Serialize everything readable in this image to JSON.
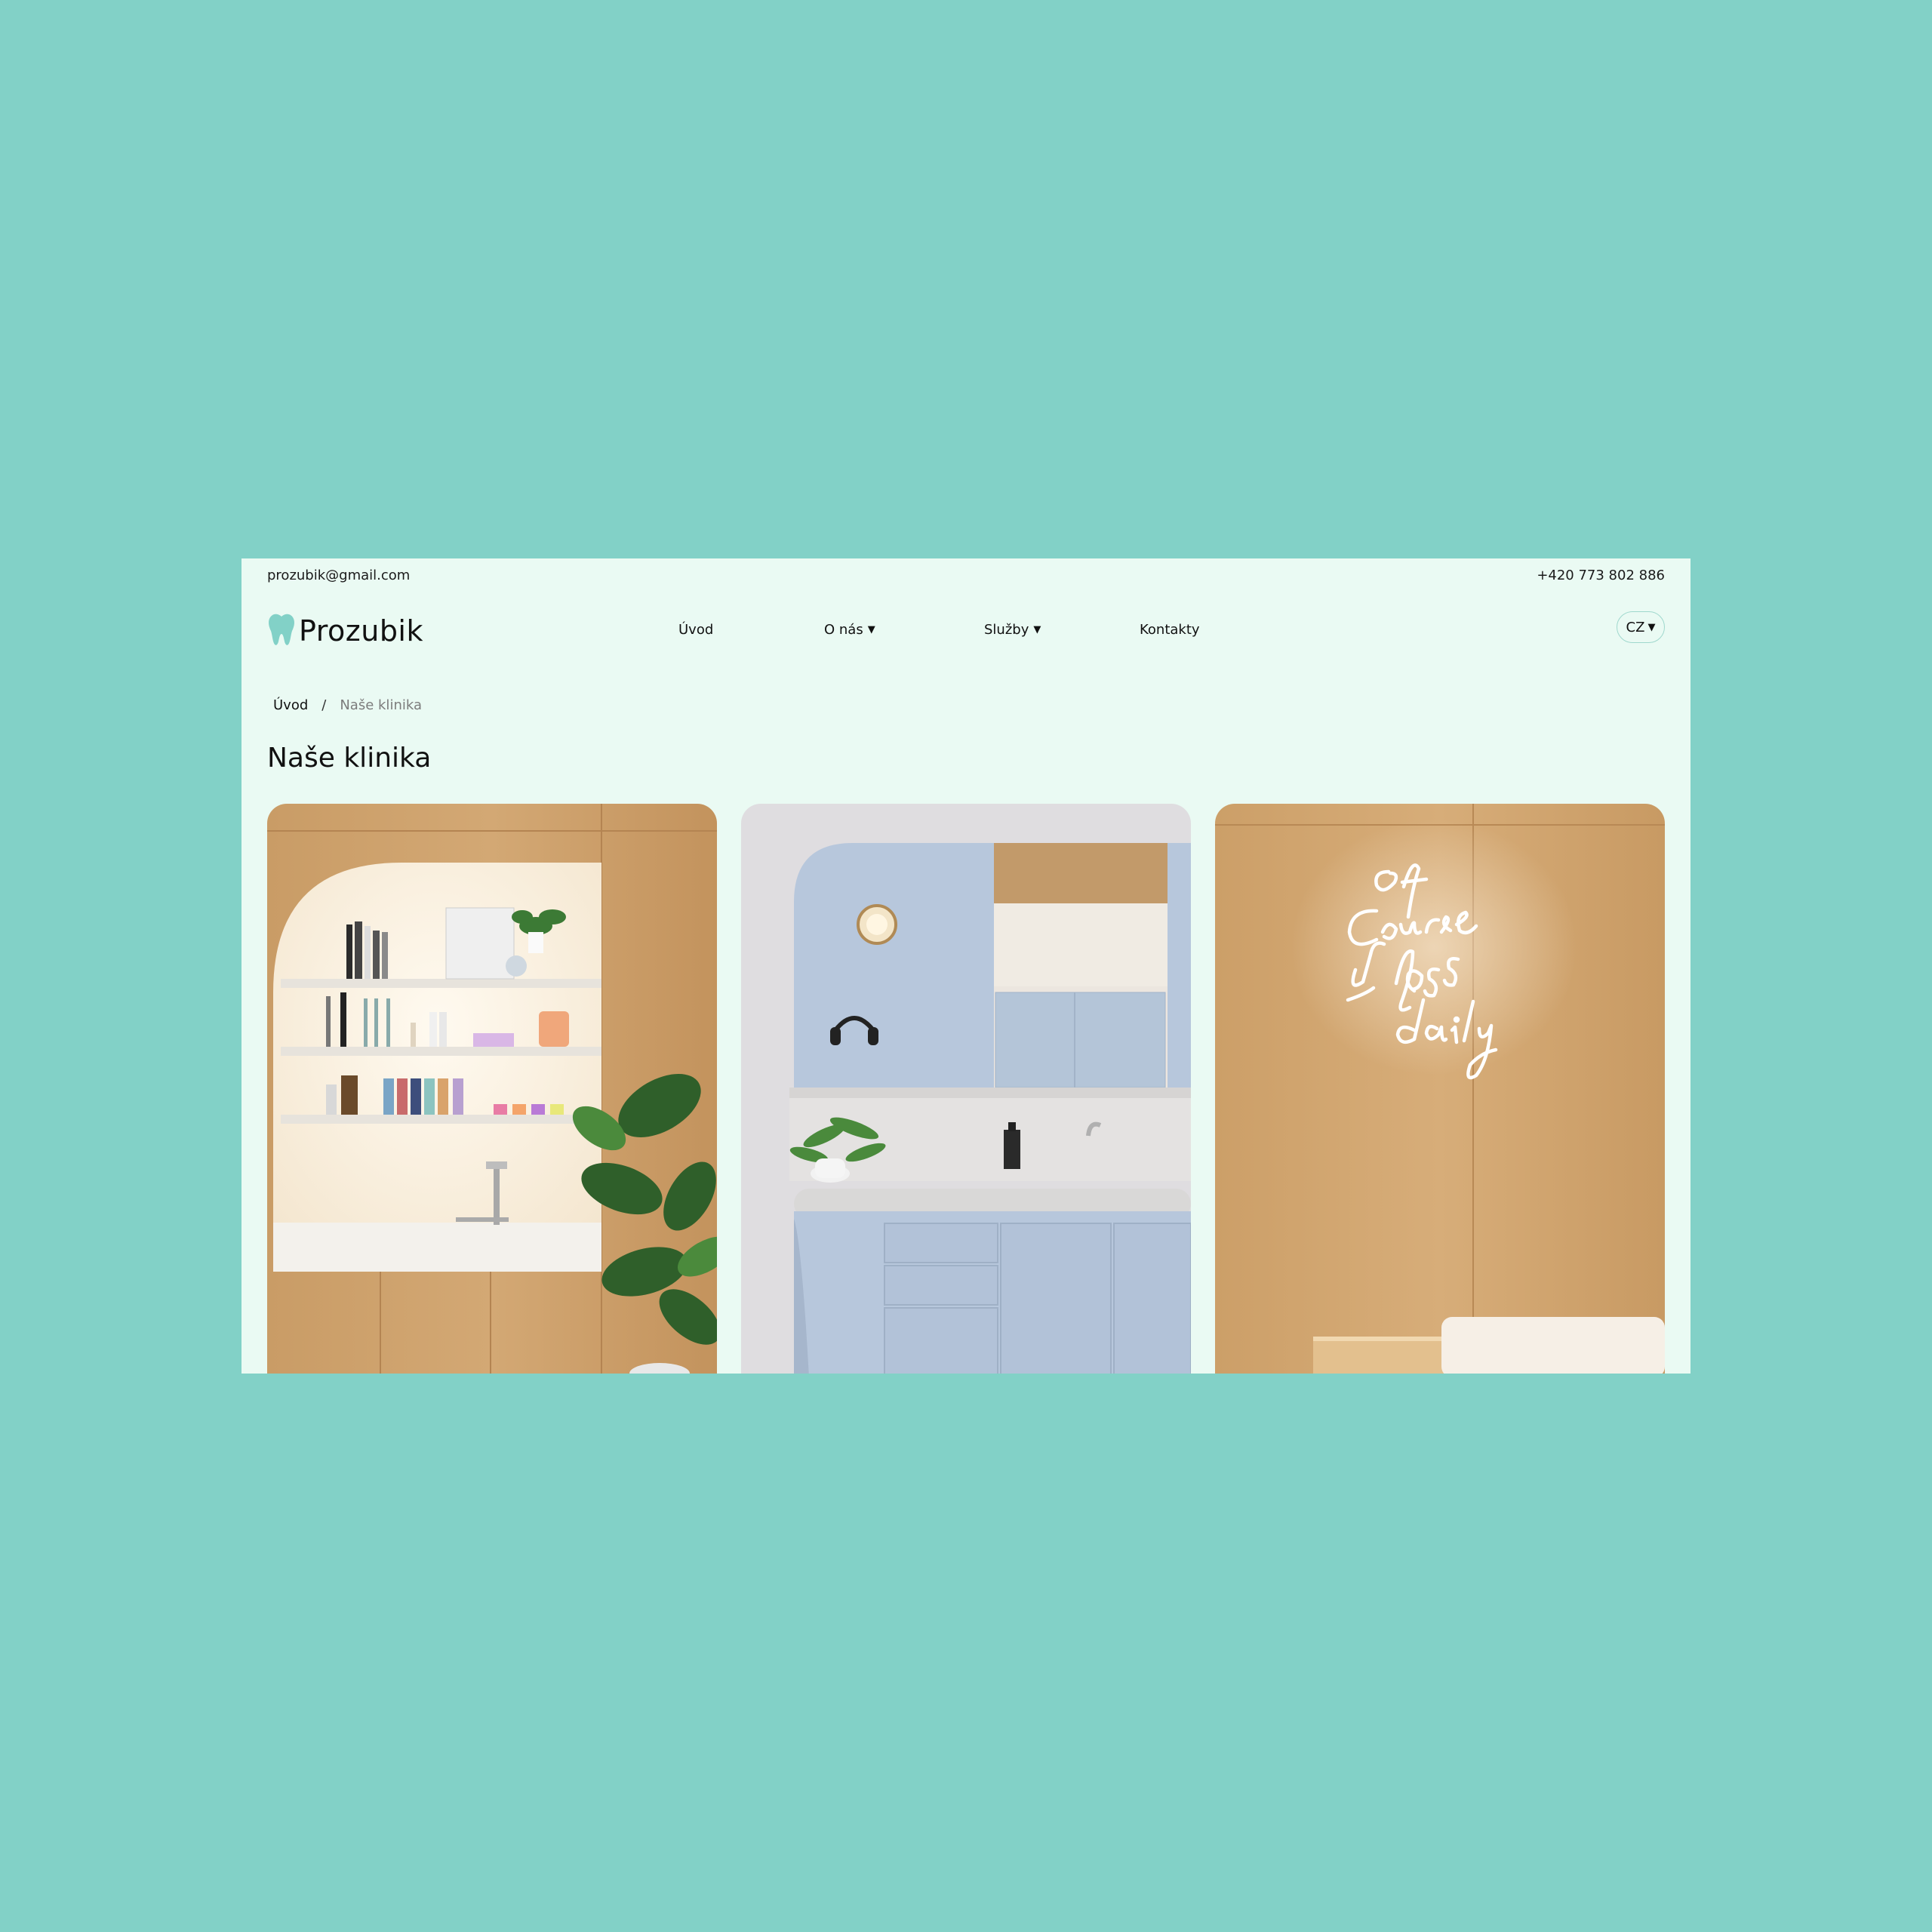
{
  "topbar": {
    "email": "prozubik@gmail.com",
    "phone": "+420 773 802 886"
  },
  "brand": {
    "name": "Prozubik",
    "logo_icon": "tooth-icon",
    "accent_color": "#82d1c7"
  },
  "nav": {
    "items": [
      {
        "label": "Úvod"
      },
      {
        "label": "O nás",
        "dropdown": true
      },
      {
        "label": "Služby",
        "dropdown": true
      },
      {
        "label": "Kontakty"
      }
    ],
    "language": "CZ"
  },
  "breadcrumb": {
    "home": "Úvod",
    "separator": "/",
    "current": "Naše klinika"
  },
  "page": {
    "title": "Naše klinika"
  },
  "gallery": {
    "photos": [
      {
        "subject": "wooden wall with lit shelves, sink and plant"
      },
      {
        "subject": "pastel blue cabinet with sink and headphones"
      },
      {
        "subject": "wooden wall with neon sign"
      }
    ],
    "neon_sign_text": "of course I floss daily"
  }
}
